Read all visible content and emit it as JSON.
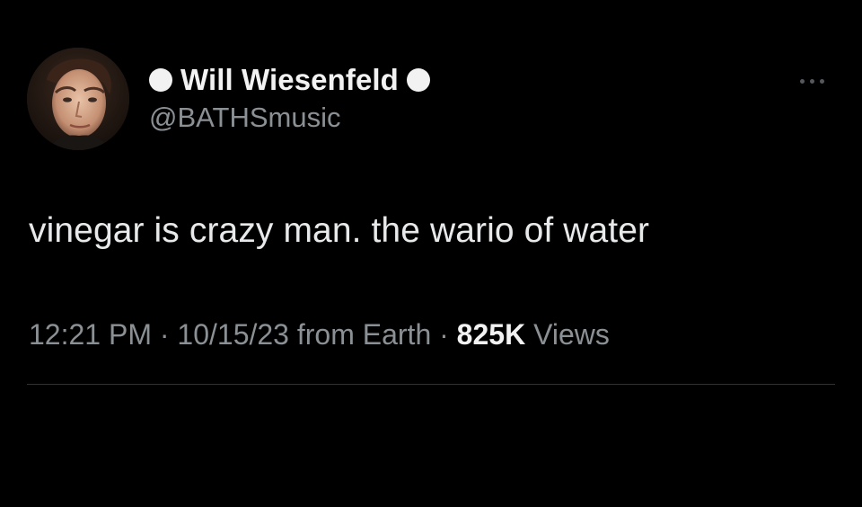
{
  "tweet": {
    "author": {
      "display_name": "Will Wiesenfeld",
      "handle": "@BATHSmusic",
      "badge_color": "#f2f2f2"
    },
    "text": "vinegar is crazy man. the wario of water",
    "meta": {
      "time": "12:21 PM",
      "separator": " · ",
      "date": "10/15/23",
      "source": "from Earth",
      "views_count": "825K",
      "views_label": "Views"
    }
  },
  "icons": {
    "more": "more-options-icon",
    "badge": "white-dot-icon"
  },
  "colors": {
    "background": "#000000",
    "primary_text": "#e7e9ea",
    "secondary_text": "#8b9095",
    "divider": "#2f3336"
  }
}
